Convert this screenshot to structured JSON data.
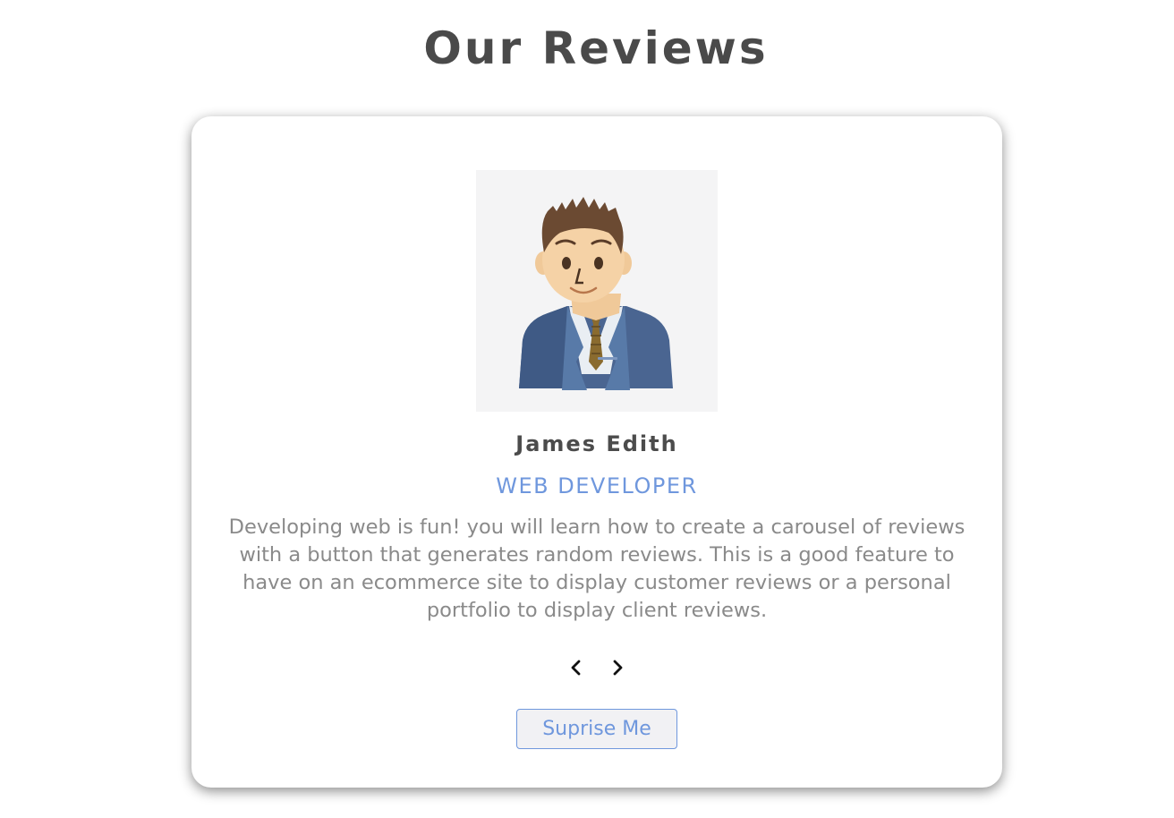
{
  "page": {
    "title": "Our Reviews"
  },
  "review": {
    "name": "James Edith",
    "job": "WEB DEVELOPER",
    "text": "Developing web is fun! you will learn how to create a carousel of reviews with a button that generates random reviews. This is a good feature to have on an ecommerce site to display customer reviews or a personal portfolio to display client reviews.",
    "avatar_icon": "businessman-avatar"
  },
  "controls": {
    "prev_icon": "chevron-left-icon",
    "next_icon": "chevron-right-icon",
    "surprise_label": "Suprise Me"
  },
  "colors": {
    "title": "#4a4a4a",
    "accent": "#6f97dd",
    "body_text": "#8a8a8a",
    "card_bg": "#ffffff",
    "avatar_bg": "#f4f4f5"
  }
}
